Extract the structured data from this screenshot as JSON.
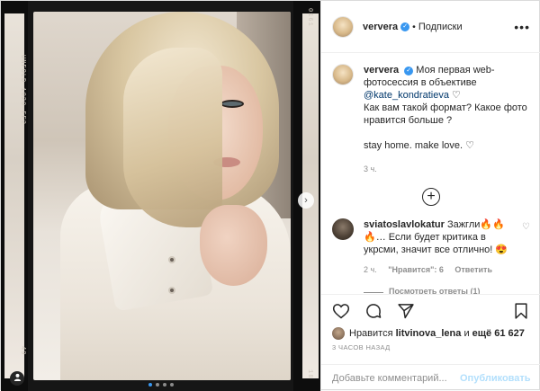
{
  "photo": {
    "film_code_left": "UNFOLD 1020 FF2",
    "film_num_left_bottom": "49",
    "film_num_right_top": "0161",
    "film_num_right_bottom": "18",
    "next_icon": "chevron-right-icon",
    "tag_icon": "user-tag-icon",
    "dots": [
      true,
      false,
      false,
      false
    ]
  },
  "header": {
    "username": "ververa",
    "separator": "•",
    "follow_label": "Подписки",
    "more_icon": "more-icon"
  },
  "caption": {
    "username": "ververa",
    "text_1": "Моя первая web-фотосессия в объективе",
    "mention": "@kate_kondratieva",
    "text_2": "Как вам такой формат? Какое фото нравится больше ?",
    "text_3": "stay home. make love.",
    "age": "3 ч."
  },
  "comment": {
    "username": "sviatoslavlokatur",
    "text": "Зажгли🔥🔥🔥… Если будет критика в укрсми, значит все отлично! 😍",
    "age": "2 ч.",
    "likes": "\"Нравится\": 6",
    "reply": "Ответить",
    "replies": "Посмотреть ответы (1)"
  },
  "likes": {
    "prefix": "Нравится",
    "user": "litvinova_lena",
    "suffix": "и",
    "count": "ещё 61 627"
  },
  "timestamp": "3 ЧАСОВ НАЗАД",
  "add_comment": {
    "placeholder": "Добавьте комментарий...",
    "publish": "Опубликовать"
  },
  "colors": {
    "accent": "#3897f0",
    "publish_disabled": "#b2dffc",
    "muted": "#8e8e8e"
  }
}
